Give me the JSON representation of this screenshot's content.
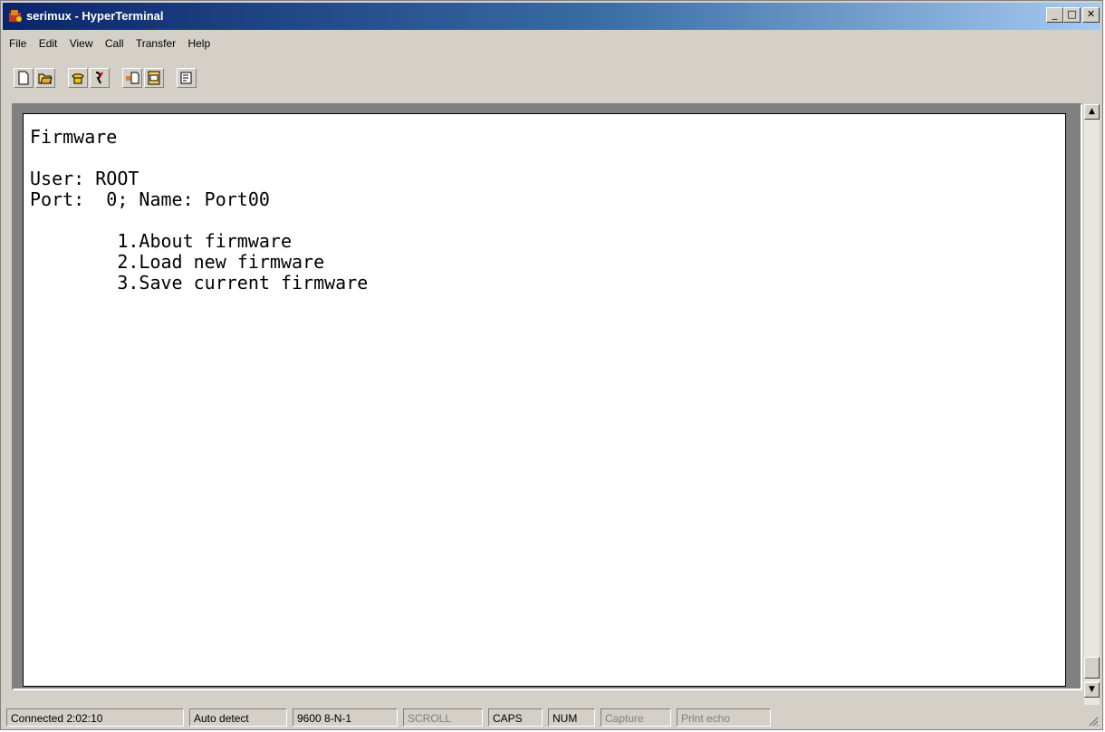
{
  "window": {
    "title": "serimux - HyperTerminal",
    "controls": {
      "minimize": "_",
      "maximize": "□",
      "close": "✕"
    }
  },
  "menu": [
    "File",
    "Edit",
    "View",
    "Call",
    "Transfer",
    "Help"
  ],
  "toolbar": {
    "icons": [
      "new-connection-icon",
      "open-icon",
      "call-icon",
      "disconnect-icon",
      "send-file-icon",
      "receive-file-icon",
      "properties-icon"
    ]
  },
  "terminal": {
    "lines": [
      "Firmware",
      "",
      "User: ROOT",
      "Port:  0; Name: Port00",
      "",
      "        1.About firmware",
      "        2.Load new firmware",
      "        3.Save current firmware"
    ]
  },
  "scrollbar": {
    "up": "▲",
    "down": "▼"
  },
  "status": {
    "connected": "Connected 2:02:10",
    "detect": "Auto detect",
    "settings": "9600 8-N-1",
    "scroll": "SCROLL",
    "caps": "CAPS",
    "num": "NUM",
    "capture": "Capture",
    "print_echo": "Print echo"
  },
  "colors": {
    "titlebar_start": "#0a246a",
    "titlebar_end": "#a6caf0",
    "chrome": "#d4d0c8"
  }
}
